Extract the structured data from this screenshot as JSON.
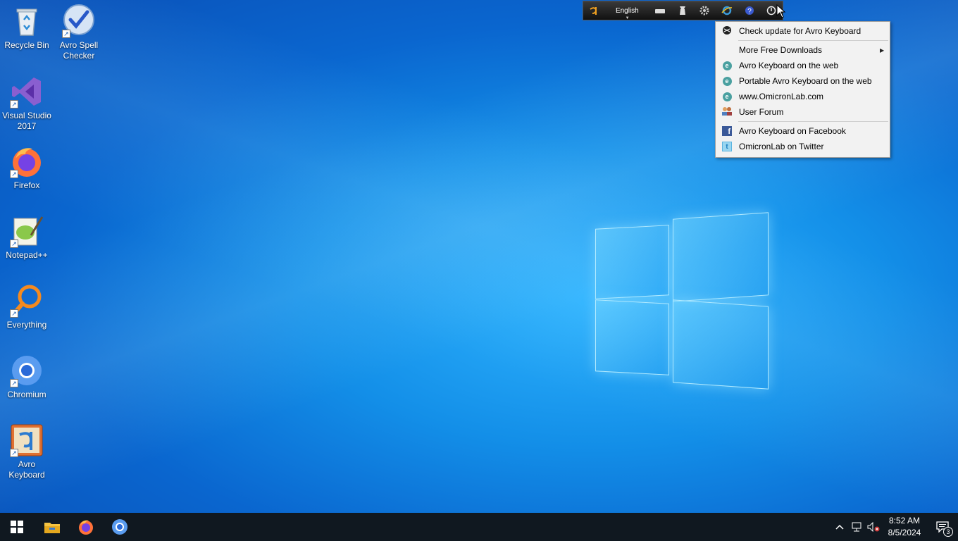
{
  "desktop": {
    "icons": [
      {
        "label": "Recycle Bin"
      },
      {
        "label": "Avro Spell Checker"
      },
      {
        "label": "Visual Studio 2017"
      },
      {
        "label": "Firefox"
      },
      {
        "label": "Notepad++"
      },
      {
        "label": "Everything"
      },
      {
        "label": "Chromium"
      },
      {
        "label": "Avro Keyboard"
      }
    ]
  },
  "avro_toolbar": {
    "language": "English",
    "icons": [
      "avro-logo-icon",
      "keyboard-layout-icon",
      "layout-editor-icon",
      "settings-icon",
      "web-icon",
      "help-icon",
      "power-icon"
    ]
  },
  "context_menu": {
    "items": [
      {
        "label": "Check update for Avro Keyboard",
        "icon": "update-icon"
      },
      {
        "label": "More Free Downloads",
        "icon": "none",
        "submenu": true
      },
      {
        "label": "Avro Keyboard on the web",
        "icon": "web-icon"
      },
      {
        "label": "Portable Avro Keyboard on the web",
        "icon": "web-icon"
      },
      {
        "label": "www.OmicronLab.com",
        "icon": "web-icon"
      },
      {
        "label": "User Forum",
        "icon": "users-icon"
      },
      {
        "label": "Avro Keyboard on Facebook",
        "icon": "facebook-icon"
      },
      {
        "label": "OmicronLab on Twitter",
        "icon": "twitter-icon"
      }
    ]
  },
  "taskbar": {
    "pinned": [
      "file-explorer-icon",
      "firefox-icon",
      "chromium-icon"
    ],
    "clock": {
      "time": "8:52 AM",
      "date": "8/5/2024"
    },
    "notifications_count": "3"
  }
}
